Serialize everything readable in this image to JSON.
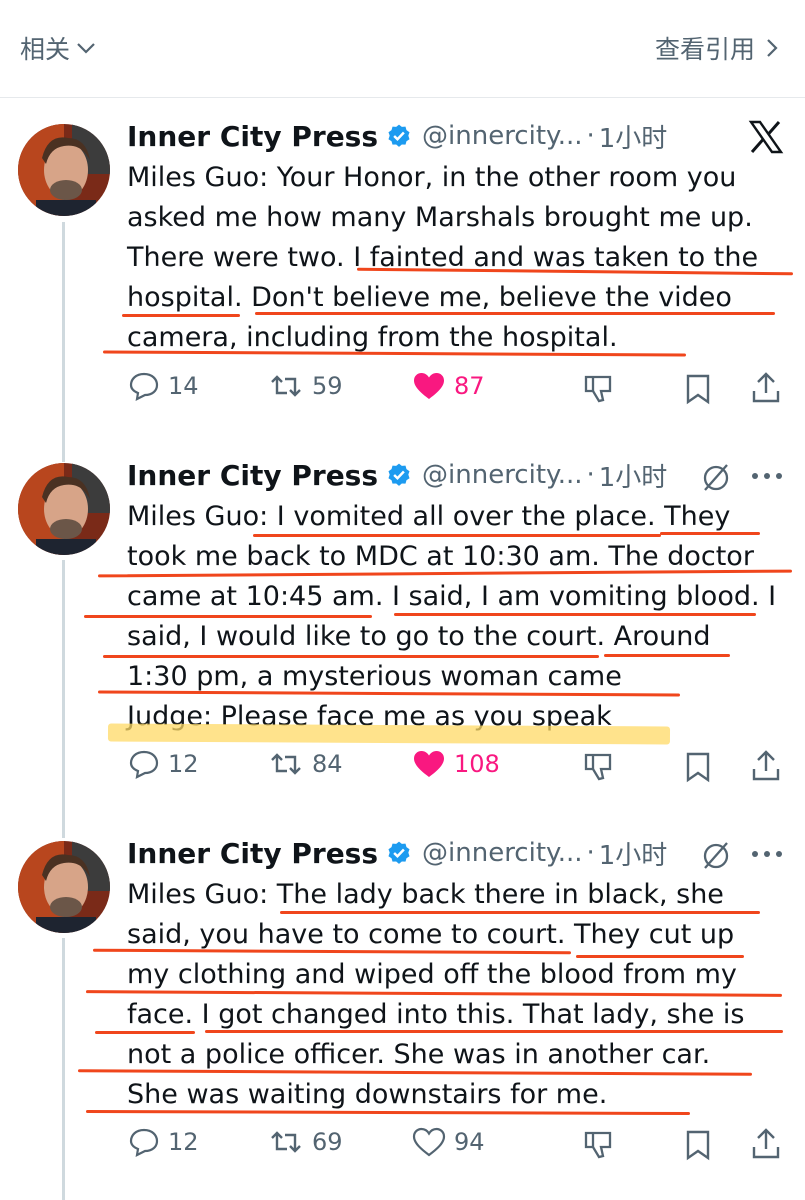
{
  "topbar": {
    "related": "相关",
    "view_quotes": "查看引用"
  },
  "tweets": [
    {
      "name": "Inner City Press",
      "handle": "@innercity...",
      "time": "1小时",
      "lines": [
        "Miles Guo: Your Honor, in the other room you",
        "asked me how many Marshals brought me up.",
        "There were two. I fainted and was taken to the",
        "hospital. Don't believe me, believe the video",
        "camera, including from the hospital."
      ],
      "replies": "14",
      "retweets": "59",
      "likes": "87",
      "liked": true
    },
    {
      "name": "Inner City Press",
      "handle": "@innercity...",
      "time": "1小时",
      "lines": [
        "Miles Guo: I vomited all over the place. They",
        "took me back to MDC at 10:30 am. The doctor",
        "came at 10:45 am. I said, I am vomiting blood. I",
        "said, I would like to go to the court. Around",
        "1:30 pm, a mysterious woman came",
        "Judge: Please face me as you speak"
      ],
      "replies": "12",
      "retweets": "84",
      "likes": "108",
      "liked": true
    },
    {
      "name": "Inner City Press",
      "handle": "@innercity...",
      "time": "1小时",
      "lines": [
        "Miles Guo: The lady back there in black, she",
        "said, you have to come to court. They cut up",
        "my clothing and wiped off the blood from my",
        "face. I got changed into this. That lady, she is",
        "not a police officer. She was in another car.",
        "She was waiting downstairs for me."
      ],
      "replies": "12",
      "retweets": "69",
      "likes": "94",
      "liked": false
    }
  ],
  "colors": {
    "like": "#f91880",
    "verified": "#1d9bf0",
    "annotation": "#f0461c",
    "highlight": "#ffd966",
    "muted": "#536471"
  },
  "icons": [
    "chevron-down-icon",
    "chevron-right-icon",
    "x-logo-icon",
    "grok-icon",
    "more-icon",
    "reply-icon",
    "retweet-icon",
    "heart-icon",
    "dislike-icon",
    "bookmark-icon",
    "share-icon",
    "verified-badge-icon"
  ]
}
